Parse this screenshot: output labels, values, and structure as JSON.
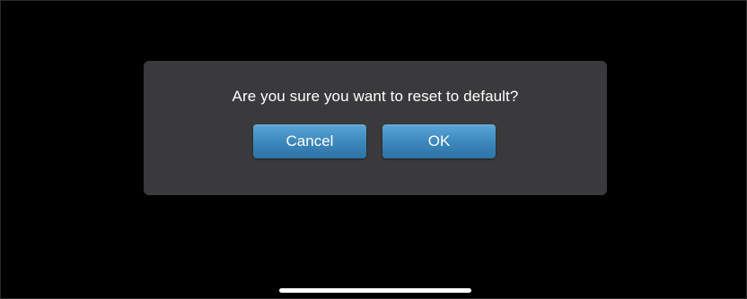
{
  "dialog": {
    "message": "Are you sure you want to reset to default?",
    "buttons": {
      "cancel_label": "Cancel",
      "ok_label": "OK"
    }
  },
  "colors": {
    "background": "#000000",
    "dialog_background": "#3a3a3c",
    "button_accent": "#3b86bb",
    "text": "#ffffff"
  }
}
